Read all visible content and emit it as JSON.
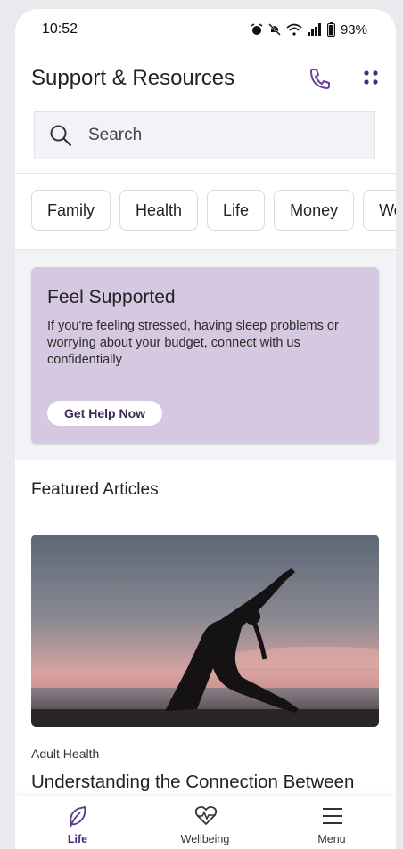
{
  "status_bar": {
    "time": "10:52",
    "battery": "93%"
  },
  "header": {
    "title": "Support & Resources",
    "phone_icon": "phone-icon",
    "more_icon": "more-dots-icon"
  },
  "search": {
    "placeholder": "Search",
    "icon": "search-icon"
  },
  "categories": [
    "Family",
    "Health",
    "Life",
    "Money",
    "We"
  ],
  "promo": {
    "title": "Feel Supported",
    "body": "If you're feeling stressed, having sleep problems or worrying about your budget, connect with us confidentially",
    "button": "Get Help Now",
    "background": "#d6c8e1"
  },
  "featured": {
    "section_title": "Featured Articles",
    "article": {
      "category": "Adult Health",
      "title": "Understanding the Connection Between"
    }
  },
  "tabbar": {
    "tabs": [
      {
        "label": "Life",
        "icon": "leaf-icon",
        "active": true
      },
      {
        "label": "Wellbeing",
        "icon": "heart-pulse-icon",
        "active": false
      },
      {
        "label": "Menu",
        "icon": "hamburger-icon",
        "active": false
      }
    ]
  },
  "colors": {
    "accent": "#6b3fa0",
    "active_tab": "#4a2a78"
  }
}
